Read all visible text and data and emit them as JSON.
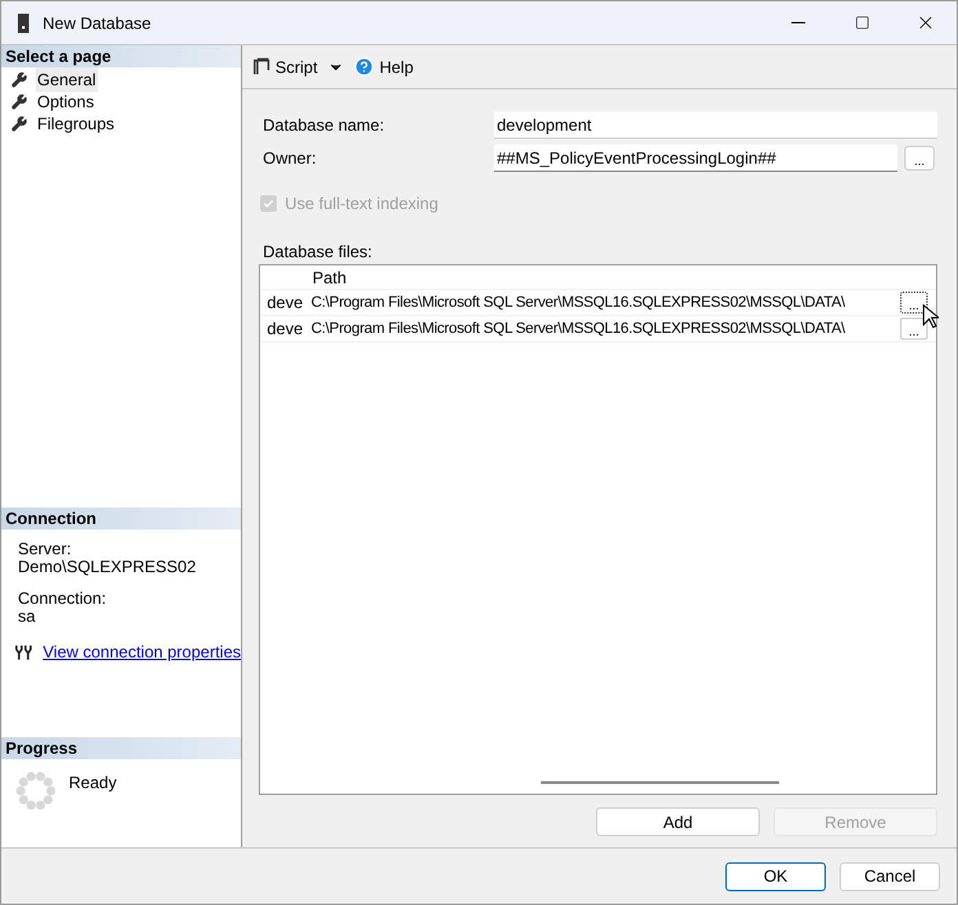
{
  "window": {
    "title": "New Database"
  },
  "sidebar": {
    "header": "Select a page",
    "items": [
      {
        "label": "General",
        "selected": true
      },
      {
        "label": "Options",
        "selected": false
      },
      {
        "label": "Filegroups",
        "selected": false
      }
    ]
  },
  "connection": {
    "header": "Connection",
    "server_label": "Server:",
    "server": "Demo\\SQLEXPRESS02",
    "connection_label": "Connection:",
    "connection": "sa",
    "link": "View connection properties"
  },
  "progress": {
    "header": "Progress",
    "status": "Ready"
  },
  "toolbar": {
    "script": "Script",
    "help": "Help"
  },
  "form": {
    "name_label": "Database name:",
    "name_value": "development",
    "owner_label": "Owner:",
    "owner_value": "##MS_PolicyEventProcessingLogin##",
    "owner_button": "...",
    "fulltext": {
      "label": "Use full-text indexing",
      "checked": true,
      "disabled": true
    }
  },
  "files": {
    "label": "Database files:",
    "columns": [
      "Path"
    ],
    "rows": [
      {
        "column_1": "deve",
        "path": "C:\\Program Files\\Microsoft SQL Server\\MSSQL16.SQLEXPRESS02\\MSSQL\\DATA\\",
        "button": "...",
        "focused": true
      },
      {
        "column_1": "deve",
        "path": "C:\\Program Files\\Microsoft SQL Server\\MSSQL16.SQLEXPRESS02\\MSSQL\\DATA\\",
        "button": "...",
        "focused": false
      }
    ]
  },
  "file_buttons": [
    {
      "label": "Add",
      "disabled": false
    },
    {
      "label": "Remove",
      "disabled": true
    }
  ],
  "dialog_buttons": [
    {
      "label": "OK",
      "selected": true
    },
    {
      "label": "Cancel",
      "selected": false
    }
  ]
}
